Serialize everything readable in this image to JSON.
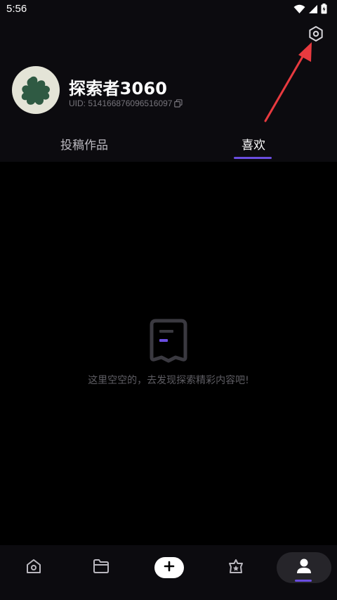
{
  "status_bar": {
    "time": "5:56",
    "icons": [
      "wifi-icon",
      "signal-icon",
      "battery-icon"
    ]
  },
  "header": {
    "settings_icon": "settings-gear-icon"
  },
  "profile": {
    "avatar_icon": "avatar-splash-icon",
    "username": "探索者3060",
    "uid": "UID: 514166876096516097",
    "copy_icon": "copy-icon"
  },
  "tabs": [
    {
      "label": "投稿作品",
      "selected": false
    },
    {
      "label": "喜欢",
      "selected": true
    }
  ],
  "empty_state": {
    "icon": "empty-box-icon",
    "text": "这里空空的，去发现探索精彩内容吧!"
  },
  "bottom_nav": [
    {
      "icon": "home-icon",
      "selected": false
    },
    {
      "icon": "folder-icon",
      "selected": false
    },
    {
      "icon": "plus-icon",
      "selected": false
    },
    {
      "icon": "star-icon",
      "selected": false
    },
    {
      "icon": "user-icon",
      "selected": true
    }
  ],
  "colors": {
    "accent": "#6a4de0",
    "annotation_arrow": "#e83a3f",
    "header_bg": "#0c0b0f",
    "avatar_bg": "#e4e4d7",
    "avatar_shape": "#2f5a43"
  }
}
